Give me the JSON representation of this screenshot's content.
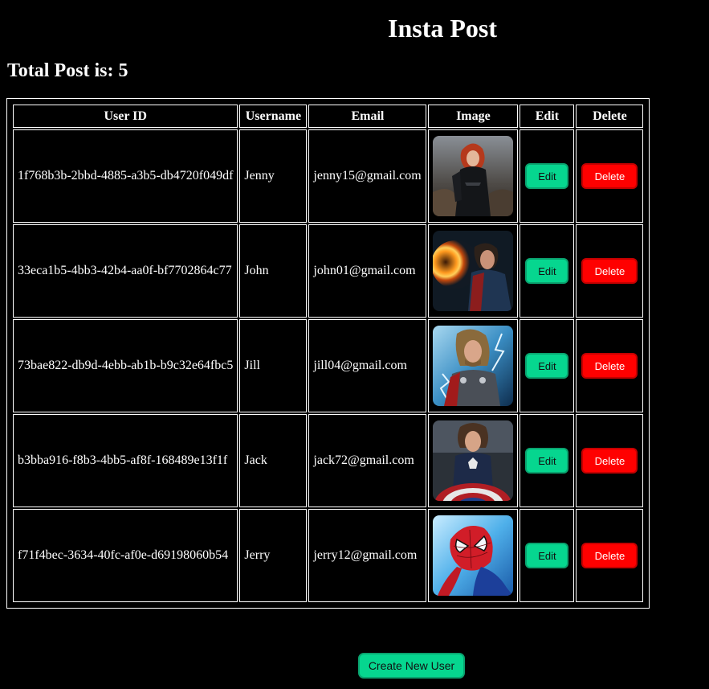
{
  "header": {
    "title": "Insta Post"
  },
  "summary": {
    "total_text": "Total Post is: 5"
  },
  "table": {
    "columns": [
      "User ID",
      "Username",
      "Email",
      "Image",
      "Edit",
      "Delete"
    ],
    "rows": [
      {
        "id": "1f768b3b-2bbd-4885-a3b5-db4720f049df",
        "username": "Jenny",
        "email": "jenny15@gmail.com",
        "image_icon": "black-widow-poster-image",
        "edit_label": "Edit",
        "delete_label": "Delete"
      },
      {
        "id": "33eca1b5-4bb3-42b4-aa0f-bf7702864c77",
        "username": "John",
        "email": "john01@gmail.com",
        "image_icon": "doctor-strange-poster-image",
        "edit_label": "Edit",
        "delete_label": "Delete"
      },
      {
        "id": "73bae822-db9d-4ebb-ab1b-b9c32e64fbc5",
        "username": "Jill",
        "email": "jill04@gmail.com",
        "image_icon": "thor-poster-image",
        "edit_label": "Edit",
        "delete_label": "Delete"
      },
      {
        "id": "b3bba916-f8b3-4bb5-af8f-168489e13f1f",
        "username": "Jack",
        "email": "jack72@gmail.com",
        "image_icon": "captain-america-poster-image",
        "edit_label": "Edit",
        "delete_label": "Delete"
      },
      {
        "id": "f71f4bec-3634-40fc-af0e-d69198060b54",
        "username": "Jerry",
        "email": "jerry12@gmail.com",
        "image_icon": "spider-man-poster-image",
        "edit_label": "Edit",
        "delete_label": "Delete"
      }
    ]
  },
  "footer": {
    "create_label": "Create New User"
  },
  "colors": {
    "background": "#000000",
    "edit_button": "#06d68f",
    "delete_button": "#ff0000",
    "text": "#ffffff"
  }
}
